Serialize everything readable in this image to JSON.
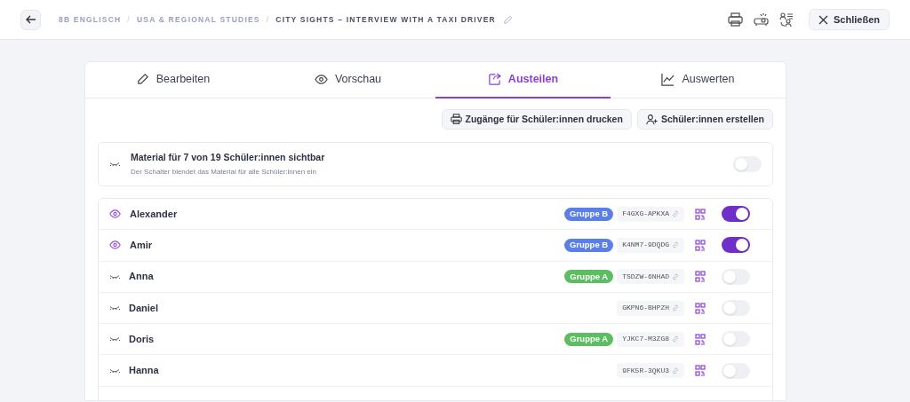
{
  "breadcrumb_separator": "/",
  "breadcrumb": [
    "8B ENGLISCH",
    "USA & REGIONAL STUDIES",
    "CITY SIGHTS – INTERVIEW WITH A TAXI DRIVER"
  ],
  "close_button": "Schließen",
  "tabs": [
    {
      "label": "Bearbeiten",
      "kind": "pencil",
      "selected": false
    },
    {
      "label": "Vorschau",
      "kind": "eye",
      "selected": false
    },
    {
      "label": "Austeilen",
      "kind": "share",
      "selected": true
    },
    {
      "label": "Auswerten",
      "kind": "chart",
      "selected": false
    }
  ],
  "actions": [
    {
      "label": "Zugänge für Schüler:innen drucken",
      "kind": "print"
    },
    {
      "label": "Schüler:innen erstellen",
      "kind": "user-add"
    }
  ],
  "visibility": {
    "title": "Material für 7 von 19 Schüler:innen sichtbar",
    "hint": "Der Schalter blendet das Material für alle Schüler:innen ein",
    "on": false
  },
  "students": [
    {
      "name": "Alexander",
      "group": "Gruppe B",
      "color": "#5b7fe8",
      "code": "F4GXG-APKXA",
      "visible": true
    },
    {
      "name": "Amir",
      "group": "Gruppe B",
      "color": "#5b7fe8",
      "code": "K4NM7-9DQDG",
      "visible": true
    },
    {
      "name": "Anna",
      "group": "Gruppe A",
      "color": "#5cbd62",
      "code": "TSDZW-6NHAD",
      "visible": false
    },
    {
      "name": "Daniel",
      "code": "GKPN6-BHPZH",
      "visible": false
    },
    {
      "name": "Doris",
      "group": "Gruppe A",
      "color": "#5cbd62",
      "code": "YJKC7-M3ZG8",
      "visible": false
    },
    {
      "name": "Hanna",
      "code": "9FK5R-3QKU3",
      "visible": false
    }
  ]
}
